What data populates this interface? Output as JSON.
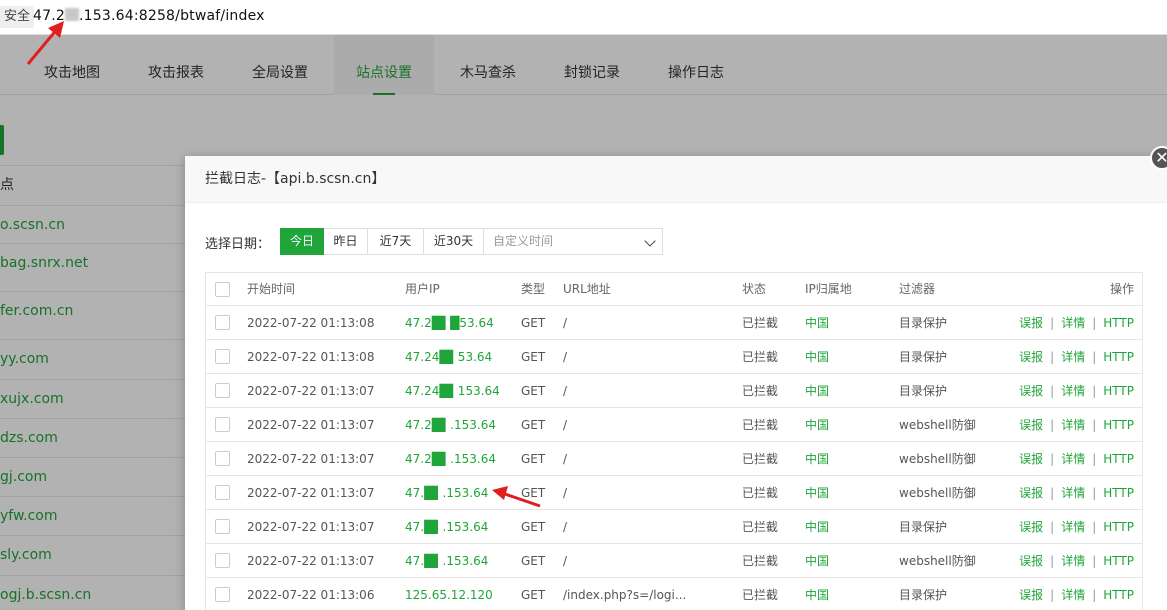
{
  "address_bar": {
    "secure_label": "安全",
    "url_prefix": "47.2",
    "url_suffix": ".153.64:8258/btwaf/index"
  },
  "nav": {
    "items": [
      "攻击地图",
      "攻击报表",
      "全局设置",
      "站点设置",
      "木马查杀",
      "封锁记录",
      "操作日志"
    ],
    "active": "站点设置"
  },
  "sites": {
    "header": "点",
    "rows": [
      "o.scsn.cn",
      "bag.snrx.net",
      "fer.com.cn",
      "yy.com",
      "xujx.com",
      "dzs.com",
      "gj.com",
      "yfw.com",
      "sly.com",
      "ogj.b.scsn.cn"
    ]
  },
  "dialog": {
    "title": "拦截日志-【api.b.scsn.cn】",
    "close_icon": "close-icon",
    "date_label": "选择日期：",
    "date_buttons": [
      "今日",
      "昨日",
      "近7天",
      "近30天"
    ],
    "active_date": "今日",
    "custom_placeholder": "自定义时间",
    "columns": [
      "开始时间",
      "用户IP",
      "类型",
      "URL地址",
      "状态",
      "IP归属地",
      "过滤器",
      "操作"
    ],
    "rows": [
      {
        "time": "2022-07-22 01:13:08",
        "ip": "47.2█▌█53.64",
        "type": "GET",
        "url": "/",
        "status": "已拦截",
        "loc": "中国",
        "filter": "目录保护"
      },
      {
        "time": "2022-07-22 01:13:08",
        "ip": "47.24█▌53.64",
        "type": "GET",
        "url": "/",
        "status": "已拦截",
        "loc": "中国",
        "filter": "目录保护"
      },
      {
        "time": "2022-07-22 01:13:07",
        "ip": "47.24█▌153.64",
        "type": "GET",
        "url": "/",
        "status": "已拦截",
        "loc": "中国",
        "filter": "目录保护"
      },
      {
        "time": "2022-07-22 01:13:07",
        "ip": "47.2█▌.153.64",
        "type": "GET",
        "url": "/",
        "status": "已拦截",
        "loc": "中国",
        "filter": "webshell防御"
      },
      {
        "time": "2022-07-22 01:13:07",
        "ip": "47.2█▌.153.64",
        "type": "GET",
        "url": "/",
        "status": "已拦截",
        "loc": "中国",
        "filter": "webshell防御"
      },
      {
        "time": "2022-07-22 01:13:07",
        "ip": "47.█▌.153.64",
        "type": "GET",
        "url": "/",
        "status": "已拦截",
        "loc": "中国",
        "filter": "webshell防御"
      },
      {
        "time": "2022-07-22 01:13:07",
        "ip": "47.█▌.153.64",
        "type": "GET",
        "url": "/",
        "status": "已拦截",
        "loc": "中国",
        "filter": "目录保护"
      },
      {
        "time": "2022-07-22 01:13:07",
        "ip": "47.█▌.153.64",
        "type": "GET",
        "url": "/",
        "status": "已拦截",
        "loc": "中国",
        "filter": "webshell防御"
      },
      {
        "time": "2022-07-22 01:13:06",
        "ip": "125.65.12.120",
        "type": "GET",
        "url": "/index.php?s=/logi...",
        "status": "已拦截",
        "loc": "中国",
        "filter": "目录保护"
      }
    ],
    "ops": {
      "report": "误报",
      "detail": "详情",
      "http": "HTTP"
    }
  },
  "colors": {
    "accent": "#20a53a",
    "annotation_arrow": "#e02020"
  }
}
